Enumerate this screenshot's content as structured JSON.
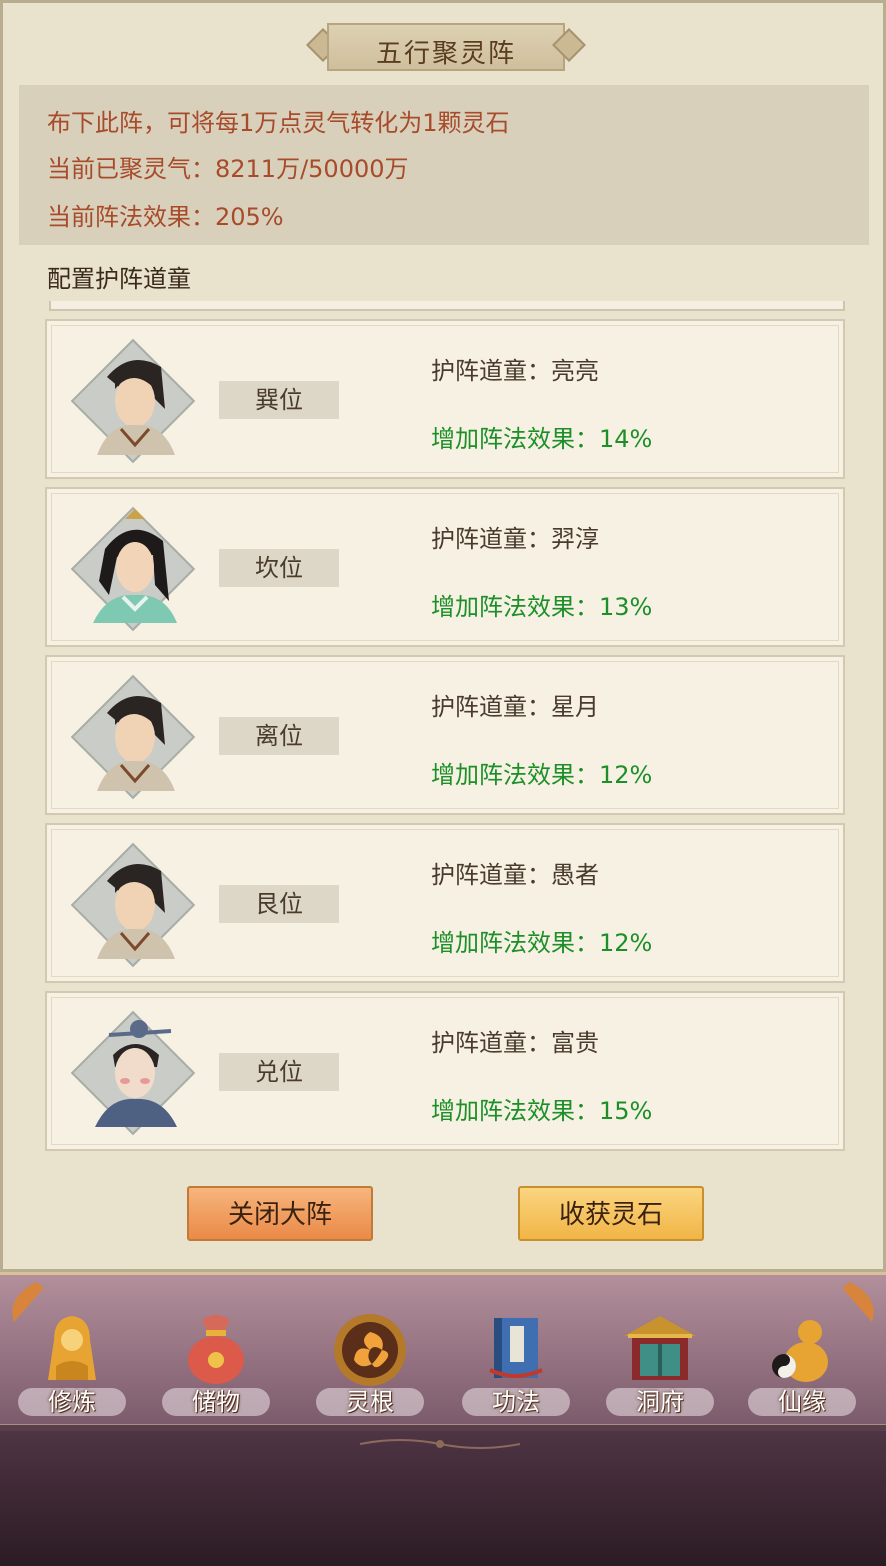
{
  "panel": {
    "title": "五行聚灵阵",
    "info": {
      "line1": "布下此阵，可将每1万点灵气转化为1颗灵石",
      "line2": "当前已聚灵气：8211万/50000万",
      "line3": "当前阵法效果：205%"
    },
    "section_label": "配置护阵道童"
  },
  "guards": [
    {
      "slot": "巽位",
      "name": "护阵道童：亮亮",
      "bonus": "增加阵法效果：14%"
    },
    {
      "slot": "坎位",
      "name": "护阵道童：羿淳",
      "bonus": "增加阵法效果：13%"
    },
    {
      "slot": "离位",
      "name": "护阵道童：星月",
      "bonus": "增加阵法效果：12%"
    },
    {
      "slot": "艮位",
      "name": "护阵道童：愚者",
      "bonus": "增加阵法效果：12%"
    },
    {
      "slot": "兑位",
      "name": "护阵道童：富贵",
      "bonus": "增加阵法效果：15%"
    }
  ],
  "buttons": {
    "close": "关闭大阵",
    "harvest": "收获灵石"
  },
  "nav": [
    {
      "label": "修炼",
      "icon": "meditation-icon"
    },
    {
      "label": "储物",
      "icon": "storage-bag-icon"
    },
    {
      "label": "灵根",
      "icon": "spirit-root-icon"
    },
    {
      "label": "功法",
      "icon": "scripture-book-icon"
    },
    {
      "label": "洞府",
      "icon": "cave-mansion-icon"
    },
    {
      "label": "仙缘",
      "icon": "gourd-icon"
    }
  ],
  "colors": {
    "info_text": "#a74b2a",
    "bonus_text": "#1c8f28",
    "panel_bg": "#e9e2cd"
  }
}
